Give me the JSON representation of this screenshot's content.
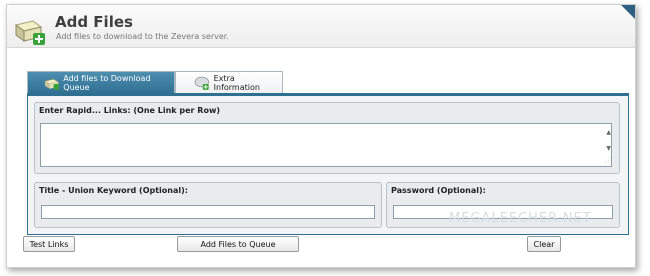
{
  "header": {
    "title": "Add Files",
    "subtitle": "Add files to download to the Zevera server.",
    "icon": "add-files-icon"
  },
  "tabs": [
    {
      "label": "Add files to Download Queue",
      "active": true,
      "icon": "download-queue-icon"
    },
    {
      "label": "Extra Information",
      "active": false,
      "icon": "extra-info-icon"
    }
  ],
  "links_group": {
    "title": "Enter Rapid... Links: (One Link per Row)",
    "value": ""
  },
  "title_group": {
    "title": "Title - Union Keyword (Optional):",
    "value": ""
  },
  "password_group": {
    "title": "Password (Optional):",
    "value": ""
  },
  "buttons": {
    "test_links": "Test Links",
    "add_to_queue": "Add Files to Queue",
    "clear": "Clear"
  },
  "watermark": "MEGALEECHER.NET",
  "colors": {
    "accent": "#2f6f92",
    "panel_bg": "#f2f4f5",
    "group_bg": "#e9ecee"
  }
}
